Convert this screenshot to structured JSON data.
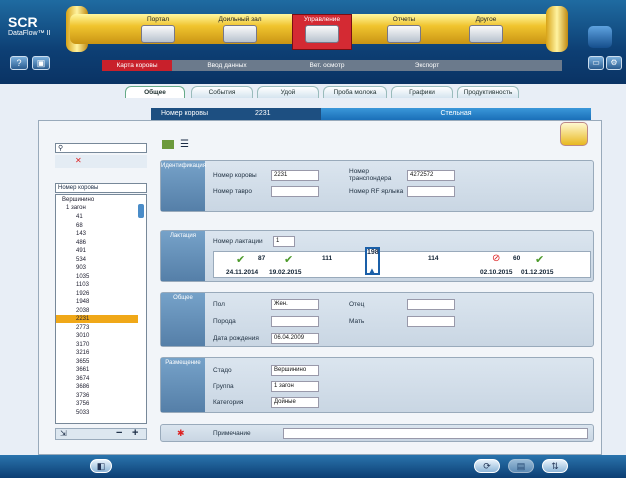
{
  "app": {
    "brand": "SCR",
    "product": "DataFlow™ II"
  },
  "header": {
    "help_label": "?",
    "modules": [
      "Портал",
      "Доильный зал",
      "Управление",
      "Отчеты",
      "Другое"
    ],
    "subnav": [
      "Карта коровы",
      "Ввод данных",
      "Вет. осмотр",
      "Экспорт"
    ]
  },
  "tabs": [
    "Общее",
    "События",
    "Удой",
    "Проба молока",
    "Графики",
    "Продуктивность"
  ],
  "cowbar": {
    "label": "Номер коровы",
    "number": "2231",
    "status": "Стельная"
  },
  "sidebar": {
    "filter": "Номер коровы",
    "root": "Вершинино",
    "group": "1 загон",
    "cows": [
      "41",
      "68",
      "143",
      "486",
      "491",
      "534",
      "903",
      "1035",
      "1103",
      "1926",
      "1948",
      "2038",
      "2231",
      "2773",
      "3010",
      "3170",
      "3216",
      "3655",
      "3661",
      "3674",
      "3686",
      "3736",
      "3756",
      "5033"
    ],
    "selected": "2231"
  },
  "ident": {
    "title": "Идентификация",
    "cow_no_label": "Номер коровы",
    "cow_no": "2231",
    "tavro_label": "Номер тавро",
    "tavro": "",
    "transp_label": "Номер транспондера",
    "transp": "4272572",
    "rf_label": "Номер RF ярлыка",
    "rf": ""
  },
  "lact": {
    "title": "Лактация",
    "no_label": "Номер лактации",
    "no": "1",
    "d1": "87",
    "d2": "111",
    "d3": "198",
    "d4": "114",
    "d5": "60",
    "date1": "24.11.2014",
    "date2": "19.02.2015",
    "date3": "02.10.2015",
    "date4": "01.12.2015"
  },
  "general": {
    "title": "Общее",
    "sex_label": "Пол",
    "sex": "Жен.",
    "breed_label": "Порода",
    "breed": "",
    "dob_label": "Дата рождения",
    "dob": "06.04.2009",
    "father_label": "Отец",
    "father": "",
    "mother_label": "Мать",
    "mother": ""
  },
  "place": {
    "title": "Размещение",
    "herd_label": "Стадо",
    "herd": "Вершинино",
    "group_label": "Группа",
    "group": "1 загон",
    "cat_label": "Категория",
    "cat": "Дойные"
  },
  "note": {
    "label": "Примечание",
    "value": ""
  }
}
